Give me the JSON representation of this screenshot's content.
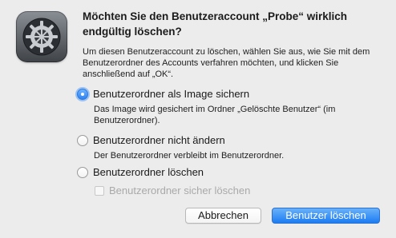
{
  "dialog": {
    "title": "Möchten Sie den Benutzeraccount „Probe“ wirklich endgültig löschen?",
    "message": "Um diesen Benutzeraccount zu löschen, wählen Sie aus, wie Sie mit dem Benutzerordner des Accounts verfahren möchten, und klicken Sie anschließend auf „OK“.",
    "app_icon": "system-preferences-gear-icon",
    "options": [
      {
        "label": "Benutzerordner als Image sichern",
        "description": "Das Image wird gesichert im Ordner „Gelöschte Benutzer“ (im Benutzerordner).",
        "selected": true
      },
      {
        "label": "Benutzerordner nicht ändern",
        "description": "Der Benutzerordner verbleibt im Benutzerordner.",
        "selected": false
      },
      {
        "label": "Benutzerordner löschen",
        "description": "",
        "selected": false
      }
    ],
    "secure_delete": {
      "label": "Benutzerordner sicher löschen",
      "checked": false,
      "enabled": false
    },
    "buttons": {
      "cancel": "Abbrechen",
      "confirm": "Benutzer löschen"
    },
    "colors": {
      "accent": "#2f82ef",
      "background": "#ececec",
      "disabled_text": "#a9a9a9"
    }
  }
}
